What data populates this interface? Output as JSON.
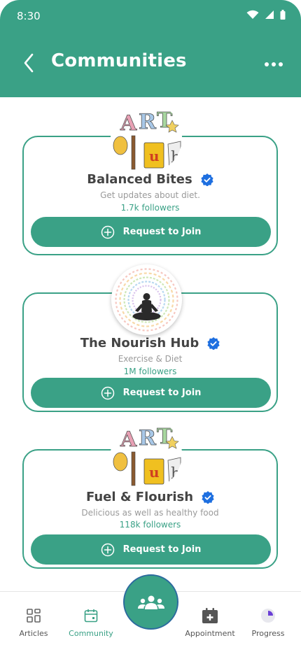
{
  "status": {
    "time": "8:30"
  },
  "header": {
    "title": "Communities"
  },
  "colors": {
    "primary": "#3aa186",
    "verified": "#1e6fe0",
    "fab_border": "#2c6b9e"
  },
  "communities": [
    {
      "name": "Balanced Bites",
      "description": "Get updates about diet.",
      "followers": "1.7k followers",
      "button_label": "Request to Join",
      "avatar": "art-logo-image",
      "verified": true
    },
    {
      "name": "The Nourish Hub",
      "description": "Exercise & Diet",
      "followers": "1M followers",
      "button_label": "Request to Join",
      "avatar": "meditation-mandala-image",
      "verified": true
    },
    {
      "name": "Fuel & Flourish",
      "description": "Delicious as well as healthy food",
      "followers": "118k followers",
      "button_label": "Request to Join",
      "avatar": "art-logo-image",
      "verified": true
    }
  ],
  "nav": {
    "articles": "Articles",
    "community": "Community",
    "appointment": "Appointment",
    "progress": "Progress"
  },
  "fab_icon": "group-icon"
}
